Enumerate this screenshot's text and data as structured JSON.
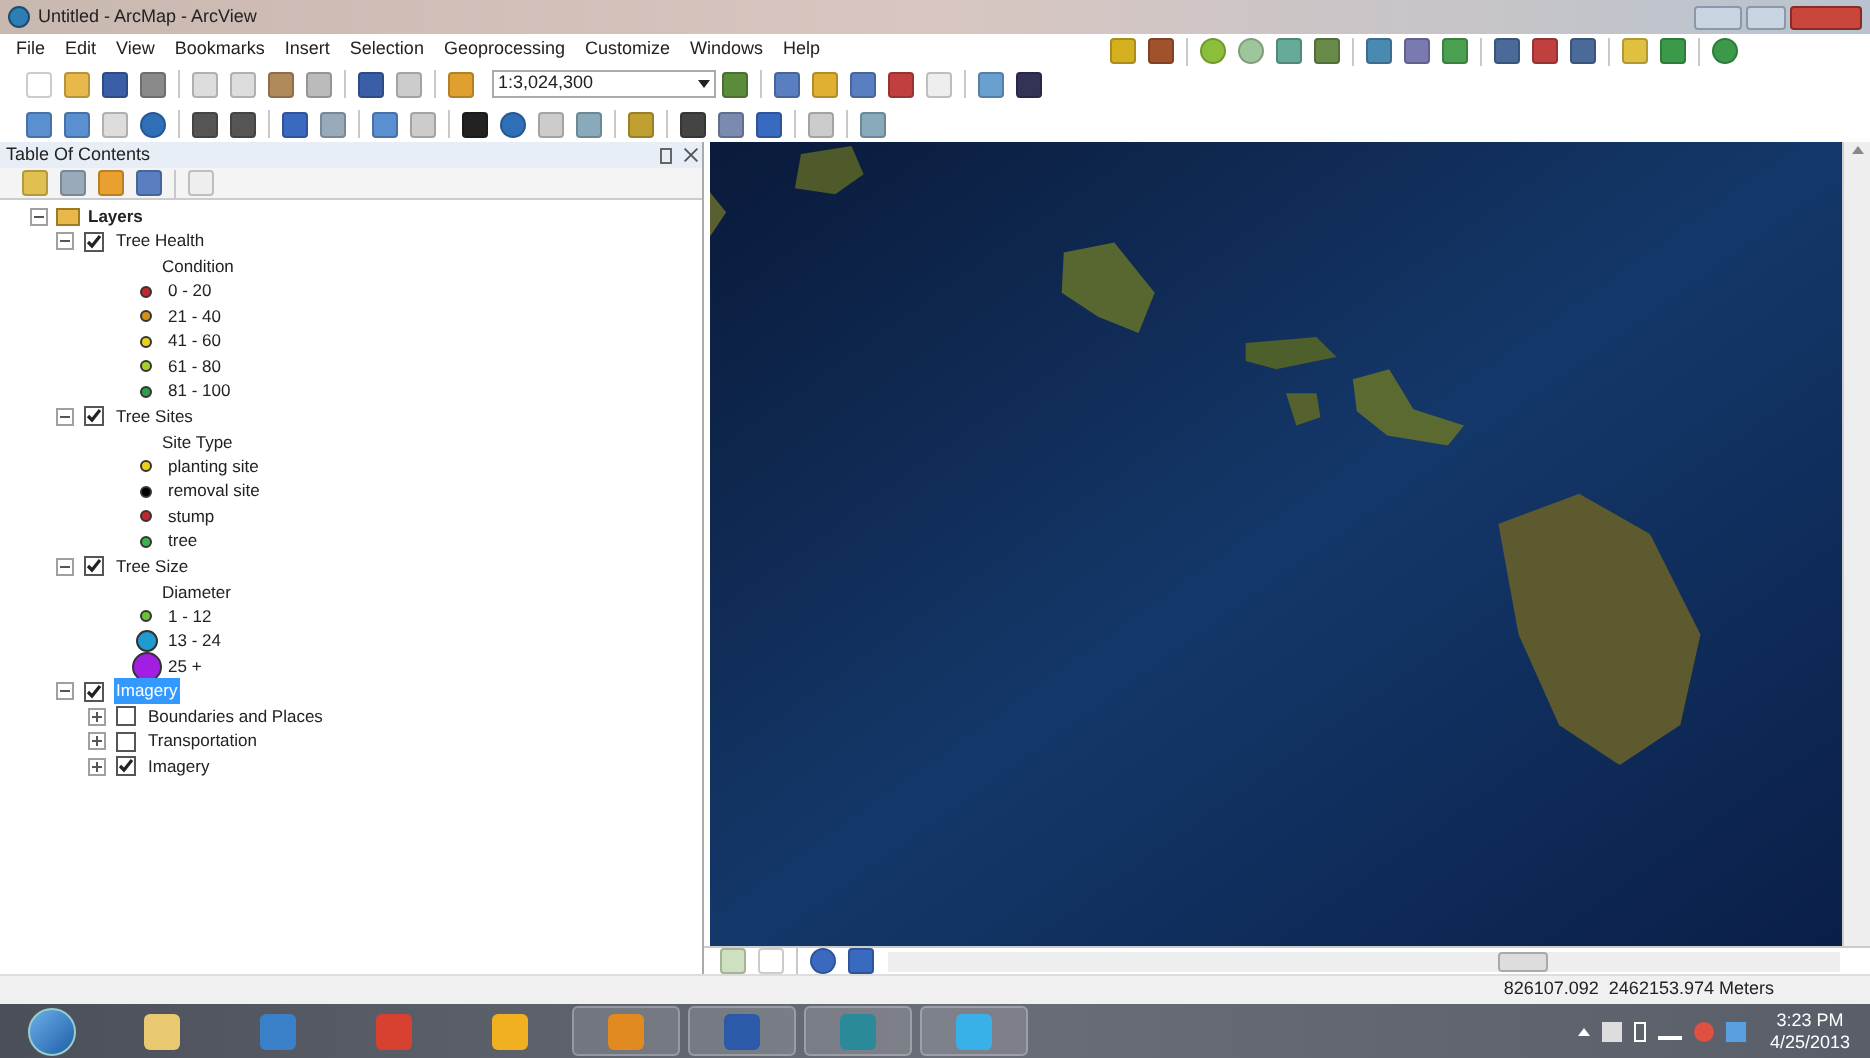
{
  "window": {
    "title": "Untitled - ArcMap - ArcView"
  },
  "menu": [
    "File",
    "Edit",
    "View",
    "Bookmarks",
    "Insert",
    "Selection",
    "Geoprocessing",
    "Customize",
    "Windows",
    "Help"
  ],
  "scale_field": {
    "value": "1:3,024,300"
  },
  "toc": {
    "title": "Table Of Contents",
    "root": {
      "label": "Layers",
      "expanded": true,
      "children": [
        {
          "label": "Tree Health",
          "checked": true,
          "expanded": true,
          "selected": false,
          "legend": {
            "heading": "Condition",
            "items": [
              {
                "label": "0 - 20",
                "color": "#c0282d",
                "kind": "small"
              },
              {
                "label": "21 - 40",
                "color": "#d4901e",
                "kind": "small"
              },
              {
                "label": "41 - 60",
                "color": "#e6d21e",
                "kind": "small"
              },
              {
                "label": "61 - 80",
                "color": "#a6cf2a",
                "kind": "small"
              },
              {
                "label": "81 - 100",
                "color": "#2f9e4a",
                "kind": "small"
              }
            ]
          }
        },
        {
          "label": "Tree Sites",
          "checked": true,
          "expanded": true,
          "selected": false,
          "legend": {
            "heading": "Site Type",
            "items": [
              {
                "label": "planting site",
                "color": "#e6d21e",
                "kind": "small"
              },
              {
                "label": "removal site",
                "color": "#000000",
                "kind": "small"
              },
              {
                "label": "stump",
                "color": "#c0282d",
                "kind": "small"
              },
              {
                "label": "tree",
                "color": "#3cb34a",
                "kind": "small"
              }
            ]
          }
        },
        {
          "label": "Tree Size",
          "checked": true,
          "expanded": true,
          "selected": false,
          "legend": {
            "heading": "Diameter",
            "items": [
              {
                "label": "1 - 12",
                "color": "#6cc03a",
                "kind": "small"
              },
              {
                "label": "13 - 24",
                "color": "#1f9bd0",
                "kind": "medium"
              },
              {
                "label": "25 +",
                "color": "#a21ee0",
                "kind": "large"
              }
            ]
          }
        },
        {
          "label": "Imagery",
          "checked": true,
          "expanded": true,
          "selected": true,
          "children": [
            {
              "label": "Boundaries and Places",
              "checked": false,
              "expanded": false
            },
            {
              "label": "Transportation",
              "checked": false,
              "expanded": false
            },
            {
              "label": "Imagery",
              "checked": true,
              "expanded": false
            }
          ]
        }
      ]
    }
  },
  "status_bar": {
    "coordinates": "826107.092  2462153.974 Meters"
  },
  "taskbar": {
    "time": "3:23 PM",
    "date": "4/25/2013"
  }
}
